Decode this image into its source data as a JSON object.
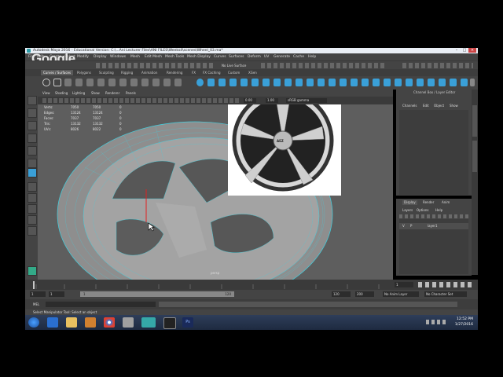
{
  "window": {
    "title": "Autodesk Maya 2016 - Educational Version: C:\\...Ani Lecturer Files\\ANI FILES\\Weeks4\\scenes\\Wheel_03.ma*"
  },
  "overlay": {
    "watermark": "Google"
  },
  "menubar": {
    "items": [
      "File",
      "Edit",
      "Create",
      "Select",
      "Modify",
      "Display",
      "Windows",
      "Mesh",
      "Edit Mesh",
      "Mesh Tools",
      "Mesh Display",
      "Curves",
      "Surfaces",
      "Deform",
      "UV",
      "Generate",
      "Cache",
      "Help"
    ]
  },
  "statusline": {
    "live_surface": "No Live Surface"
  },
  "shelf": {
    "tabs": [
      "Curves / Surfaces",
      "Polygons",
      "Sculpting",
      "Rigging",
      "Animation",
      "Rendering",
      "FX",
      "FX Caching",
      "Custom",
      "XGen"
    ]
  },
  "viewport": {
    "menu": [
      "View",
      "Shading",
      "Lighting",
      "Show",
      "Renderer",
      "Panels"
    ],
    "exposure": "0.00",
    "gamma": "1.00",
    "colorspace": "sRGB gamma",
    "camera_label": "persp",
    "hud": {
      "rows": [
        {
          "label": "Verts:",
          "a": "7050",
          "b": "7050",
          "c": "0"
        },
        {
          "label": "Edges:",
          "a": "13124",
          "b": "13124",
          "c": "0"
        },
        {
          "label": "Faces:",
          "a": "7037",
          "b": "7037",
          "c": "0"
        },
        {
          "label": "Tris:",
          "a": "13132",
          "b": "13132",
          "c": "0"
        },
        {
          "label": "UVs:",
          "a": "8026",
          "b": "8022",
          "c": "0"
        }
      ]
    },
    "ref_image_text": "AEZ"
  },
  "channelbox": {
    "header": "Channel Box / Layer Editor",
    "menu": [
      "Channels",
      "Edit",
      "Object",
      "Show"
    ]
  },
  "layers": {
    "tabs": [
      "Display",
      "Render",
      "Anim"
    ],
    "menu": [
      "Layers",
      "Options",
      "Help"
    ],
    "row": {
      "v": "V",
      "p": "P",
      "name": "layer1"
    }
  },
  "timeline": {
    "start": "1",
    "range_start": "1",
    "range_end": "120",
    "end": "120",
    "max": "200",
    "current": "1",
    "anim_layer": "No Anim Layer",
    "char_set": "No Character Set"
  },
  "cmdline": {
    "label": "MEL"
  },
  "helpline": {
    "text": "Select Manipulator Tool: Select an object"
  },
  "taskbar": {
    "time": "12:52 PM",
    "date": "1/27/2016"
  },
  "colors": {
    "maya_bg": "#444444",
    "viewport_bg": "#5e5e5e",
    "wire": "#40d0e0",
    "taskbar": "#1e2a40"
  }
}
